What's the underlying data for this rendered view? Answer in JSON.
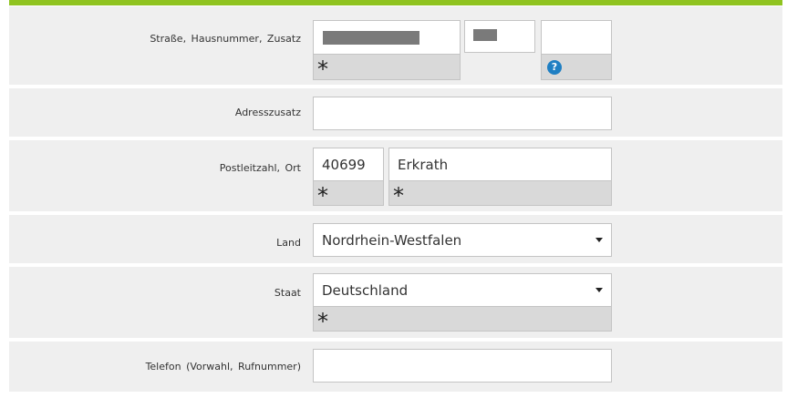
{
  "form": {
    "street": {
      "label": "Straße, Hausnummer, Zusatz",
      "required_mark": "*",
      "help_label": "?"
    },
    "address_suffix": {
      "label": "Adresszusatz",
      "value": ""
    },
    "postal": {
      "label": "Postleitzahl, Ort",
      "zip_value": "40699",
      "city_value": "Erkrath",
      "required_mark": "*"
    },
    "state": {
      "label": "Land",
      "selected": "Nordrhein-Westfalen"
    },
    "country": {
      "label": "Staat",
      "selected": "Deutschland",
      "required_mark": "*"
    },
    "phone": {
      "label": "Telefon (Vorwahl, Rufnummer)",
      "value": ""
    }
  },
  "colors": {
    "accent_bar": "#8fc31f",
    "row_background": "#efefef",
    "required_background": "#d9d9d9",
    "help_icon": "#1f7fc3"
  }
}
